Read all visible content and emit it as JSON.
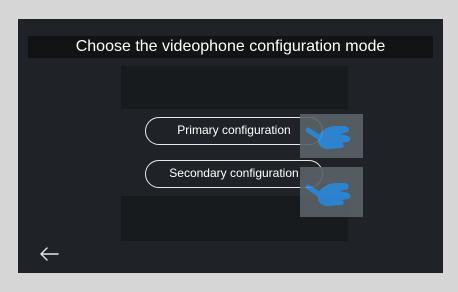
{
  "header": {
    "title": "Choose the videophone configuration mode"
  },
  "options": {
    "primary_label": "Primary configuration",
    "secondary_label": "Secondary configuration"
  },
  "icons": {
    "back": "back-arrow-icon",
    "hand": "hand-pointer-icon"
  },
  "colors": {
    "screen_bg": "#1f2327",
    "bezel": "#d6d6d6",
    "hand_accent": "#2f8ee0"
  }
}
